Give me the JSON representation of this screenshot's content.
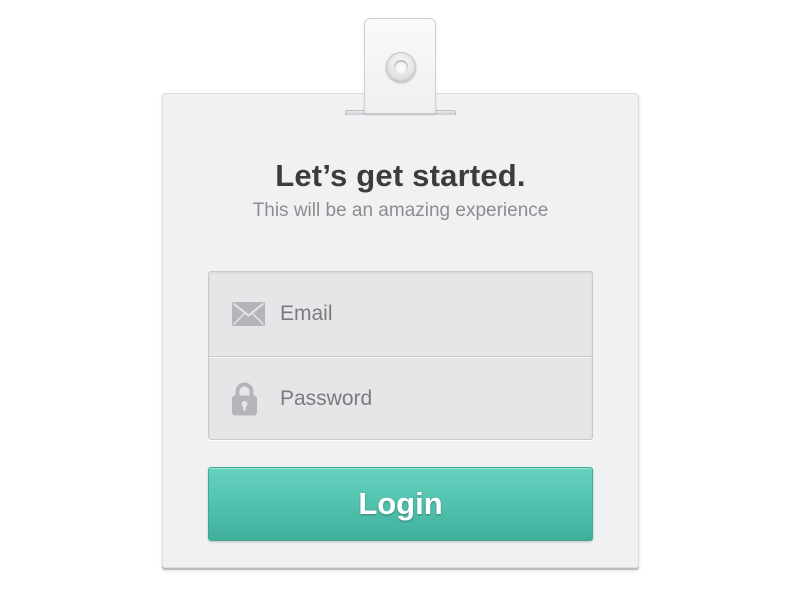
{
  "card": {
    "title": "Let’s get started.",
    "subtitle": "This will be an amazing experience"
  },
  "fields": {
    "email": {
      "placeholder": "Email",
      "value": "",
      "icon": "envelope-icon"
    },
    "password": {
      "placeholder": "Password",
      "value": "",
      "icon": "lock-icon"
    }
  },
  "login_button": {
    "label": "Login"
  },
  "colors": {
    "accent": "#50c0ac",
    "card_background": "#f0f1f2",
    "field_background": "#e5e6e8",
    "title_text": "#3b3c3e",
    "subtitle_text": "#8b8d90",
    "icon": "#b3b5b8"
  }
}
